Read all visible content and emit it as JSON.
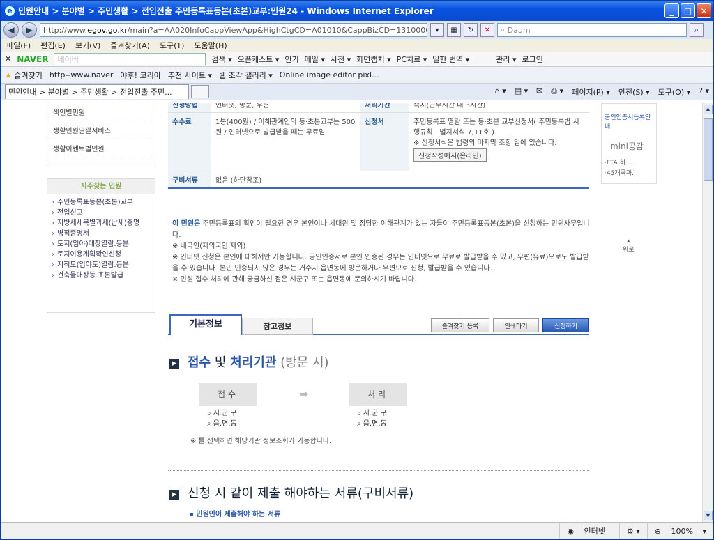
{
  "window": {
    "title": "민원안내 > 분야별 > 주민생활 > 전입전출 주민등록표등본(초본)교부:민원24 - Windows Internet Explorer"
  },
  "address": {
    "url_prefix": "http://www.",
    "url_domain": "egov.go.kr",
    "url_path": "/main?a=AA020InfoCappViewApp&HighCtgCD=A01010&CappBizCD=1310000015",
    "search_placeholder": "Daum"
  },
  "menu": [
    "파일(F)",
    "편집(E)",
    "보기(V)",
    "즐겨찾기(A)",
    "도구(T)",
    "도움말(H)"
  ],
  "naver": {
    "logo": "NAVER",
    "search_placeholder": "네이버",
    "items": [
      "검색 ▾",
      "오픈캐스트 ▾",
      "인기",
      "메일 ▾",
      "사전 ▾",
      "화면캡처 ▾",
      "PC치료 ▾",
      "일한 번역 ▾",
      "관리 ▾",
      "로그인"
    ]
  },
  "favorites": {
    "label": "즐겨찾기",
    "items": [
      "http--www.naver",
      "야후! 코리아",
      "추천 사이트 ▾",
      "웹 조각 갤러리 ▾",
      "Online image editor pixl..."
    ]
  },
  "tab": {
    "label": "민원안내 > 분야별 > 주민생활 > 전입전출 주민..."
  },
  "tools": [
    "페이지(P) ▾",
    "안전(S) ▾",
    "도구(O) ▾"
  ],
  "left": {
    "links": [
      "색인별민원",
      "생활민원일괄서비스",
      "생활이벤트별민원"
    ],
    "faq_title": "자주찾는 민원",
    "faq": [
      "주민등록표등본(초본)교부",
      "전입신고",
      "지방세세목별과세(납세)증명",
      "병적증명서",
      "토지(임야)대장열람.등본",
      "토지이용계획확인신청",
      "지적도(임야도)열람.등본",
      "건축물대장등.초본발급"
    ]
  },
  "info": {
    "row0": {
      "h1": "신청방법",
      "v1": "인터넷, 방문, 우편",
      "h2": "처리기간",
      "v2": "즉시(근무시간 내 3시간)"
    },
    "row1": {
      "h1": "수수료",
      "v1": "1통(400원) / 이해관계인의 등·초본교부는 500원 / 인터넷으로 발급받을 때는 무료임",
      "h2": "신청서",
      "v2": "주민등록표 열람 또는 등·초본 교부신청서( 주민등록법 시행규칙 : 별지서식 7,11호 )",
      "v2_note": "※ 신청서식은 법령의 마지막 조항 밑에 있습니다.",
      "btn": "신청작성예시(온라인)"
    },
    "row2": {
      "h1": "구비서류",
      "v1": "없음 (하단참조)"
    }
  },
  "notice": {
    "lead": "이 민원은",
    "lines": [
      " 주민등록표의 확인이 필요한 경우 본인이나 세대원 및 정당한 이해관계가 있는 자들이 주민등록표등본(초본)을 신청하는 민원사무입니다.",
      "※ 내국인(재외국인 제외)",
      "※ 인터넷 신청은 본인에 대해서만 가능합니다. 공인인증서로 본인 인증된 경우는 인터넷으로 무료로 발급받을 수 있고, 우편(유료)으로도 발급받을 수 있습니다. 본인 인증되지 않은 경우는 거주지 읍면동에 방문하거나 우편으로 신청, 발급받을 수 있습니다.",
      "※ 민원 접수·처리에 관해 궁금하신 점은 시군구 또는 읍면동에 문의하시기 바랍니다."
    ]
  },
  "right": {
    "link1": "공인인증서등록안내",
    "brand": "mini공감",
    "n1": "·FTA 허...",
    "n2": "·45개국과...",
    "top": "위로"
  },
  "tabs": {
    "basic": "기본정보",
    "ref": "참고정보",
    "fav": "즐겨찾기 등록",
    "print": "인쇄하기",
    "apply": "신청하기"
  },
  "section1": {
    "a": "접수",
    "b": " 및 ",
    "c": "처리기관",
    "d": " (방문 시)",
    "step1": "접수",
    "step2": "처리",
    "sub1": [
      "시.군.구",
      "읍.면.동"
    ],
    "sub2": [
      "시.군.구",
      "읍.면.동"
    ],
    "note": "※ 를 선택하면 해당기관 정보조회가 가능합니다."
  },
  "section2": {
    "title": "신청 시 같이 제출 해야하는 서류(구비서류)",
    "sub": "민원인이 제출해야 하는 서류"
  },
  "status": {
    "zone": "인터넷",
    "zoom": "100%"
  }
}
